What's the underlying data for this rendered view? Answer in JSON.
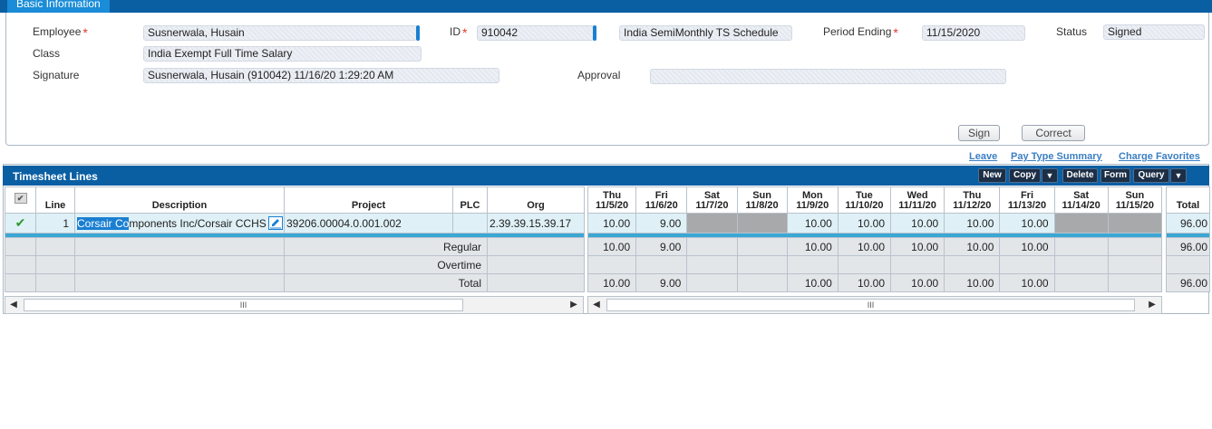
{
  "basic_info": {
    "tab_label": "Basic Information",
    "employee_label": "Employee",
    "employee_value": "Susnerwala, Husain",
    "id_label": "ID",
    "id_value": "910042",
    "schedule_value": "India SemiMonthly TS Schedule",
    "period_label": "Period Ending",
    "period_value": "11/15/2020",
    "status_label": "Status",
    "status_value": "Signed",
    "class_label": "Class",
    "class_value": "India Exempt Full Time Salary",
    "signature_label": "Signature",
    "signature_value": "Susnerwala, Husain (910042) 11/16/20 1:29:20 AM",
    "approval_label": "Approval",
    "approval_value": "",
    "required_mark": "*",
    "sign_button": "Sign",
    "correct_button": "Correct"
  },
  "links": {
    "leave": "Leave",
    "pay_type_summary": "Pay Type Summary",
    "charge_favorites": "Charge Favorites"
  },
  "timesheet": {
    "title": "Timesheet Lines",
    "toolbar": {
      "new": "New",
      "copy": "Copy",
      "delete": "Delete",
      "form": "Form",
      "query": "Query",
      "dropdown": "▼"
    },
    "headers": {
      "line": "Line",
      "description": "Description",
      "project": "Project",
      "plc": "PLC",
      "org": "Org",
      "total": "Total"
    },
    "days": [
      {
        "dow": "Thu",
        "date": "11/5/20"
      },
      {
        "dow": "Fri",
        "date": "11/6/20"
      },
      {
        "dow": "Sat",
        "date": "11/7/20"
      },
      {
        "dow": "Sun",
        "date": "11/8/20"
      },
      {
        "dow": "Mon",
        "date": "11/9/20"
      },
      {
        "dow": "Tue",
        "date": "11/10/20"
      },
      {
        "dow": "Wed",
        "date": "11/11/20"
      },
      {
        "dow": "Thu",
        "date": "11/12/20"
      },
      {
        "dow": "Fri",
        "date": "11/13/20"
      },
      {
        "dow": "Sat",
        "date": "11/14/20"
      },
      {
        "dow": "Sun",
        "date": "11/15/20"
      }
    ],
    "line1": {
      "check": "✔",
      "line": "1",
      "description_selected": "Corsair Co",
      "description_rest": "mponents Inc/Corsair CCHS",
      "project": "39206.00004.0.001.002",
      "plc": "",
      "org": "2.39.39.15.39.17",
      "hours": [
        "10.00",
        "9.00",
        "",
        "",
        "10.00",
        "10.00",
        "10.00",
        "10.00",
        "10.00",
        "",
        ""
      ],
      "total": "96.00"
    },
    "summary": [
      {
        "label": "Regular",
        "hours": [
          "10.00",
          "9.00",
          "",
          "",
          "10.00",
          "10.00",
          "10.00",
          "10.00",
          "10.00",
          "",
          ""
        ],
        "total": "96.00"
      },
      {
        "label": "Overtime",
        "hours": [
          "",
          "",
          "",
          "",
          "",
          "",
          "",
          "",
          "",
          "",
          ""
        ],
        "total": ""
      },
      {
        "label": "Total",
        "hours": [
          "10.00",
          "9.00",
          "",
          "",
          "10.00",
          "10.00",
          "10.00",
          "10.00",
          "10.00",
          "",
          ""
        ],
        "total": "96.00"
      }
    ],
    "scroll_grip": "III",
    "scroll_left": "◀",
    "scroll_right": "▶"
  },
  "colors": {
    "header_blue": "#0a5fa3",
    "tab_blue": "#1a8cd8",
    "row_highlight": "#dff1f7",
    "check_green": "#2e9a2e",
    "required_red": "#e03a2a"
  }
}
